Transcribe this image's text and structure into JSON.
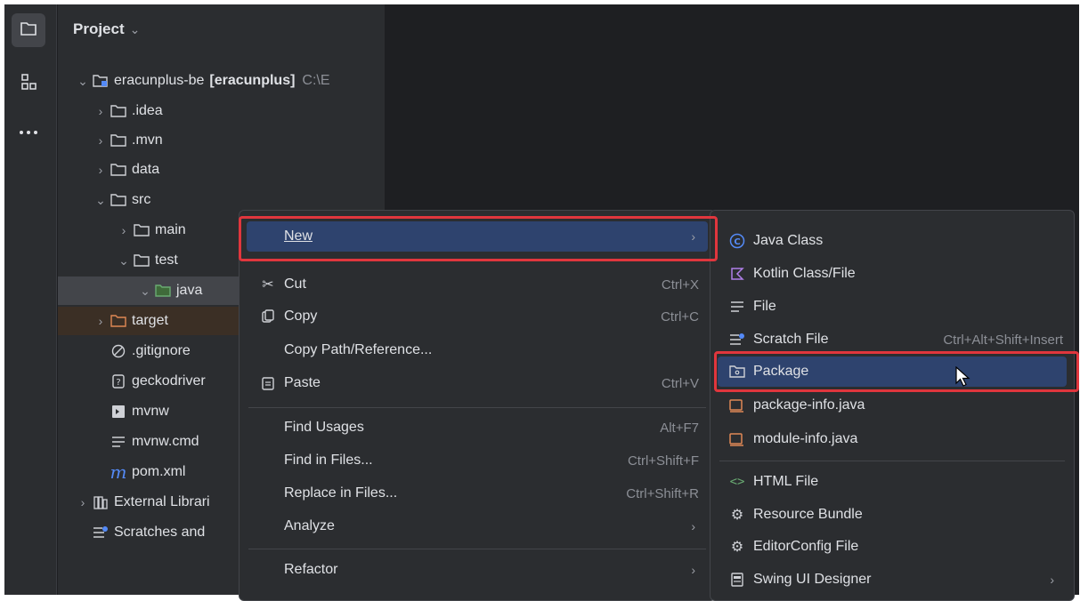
{
  "toolstrip": {
    "items": [
      {
        "icon": "folder-icon",
        "active": true
      },
      {
        "icon": "structure-icon",
        "active": false
      },
      {
        "icon": "more-icon",
        "active": false
      }
    ]
  },
  "project_panel": {
    "title": "Project",
    "tree": [
      {
        "label": "eracunplus-be",
        "module": "[eracunplus]",
        "path": "C:\\E"
      },
      {
        "label": ".idea"
      },
      {
        "label": ".mvn"
      },
      {
        "label": "data"
      },
      {
        "label": "src"
      },
      {
        "label": "main"
      },
      {
        "label": "test"
      },
      {
        "label": "java"
      },
      {
        "label": "target"
      },
      {
        "label": ".gitignore"
      },
      {
        "label": "geckodriver"
      },
      {
        "label": "mvnw"
      },
      {
        "label": "mvnw.cmd"
      },
      {
        "label": "pom.xml"
      },
      {
        "label": "External Librari"
      },
      {
        "label": "Scratches and"
      }
    ]
  },
  "context_menu": {
    "items": [
      {
        "label": "New",
        "shortcut": ""
      },
      {
        "label": "Cut",
        "shortcut": "Ctrl+X"
      },
      {
        "label": "Copy",
        "shortcut": "Ctrl+C"
      },
      {
        "label": "Copy Path/Reference...",
        "shortcut": ""
      },
      {
        "label": "Paste",
        "shortcut": "Ctrl+V"
      },
      {
        "label": "Find Usages",
        "shortcut": "Alt+F7"
      },
      {
        "label": "Find in Files...",
        "shortcut": "Ctrl+Shift+F"
      },
      {
        "label": "Replace in Files...",
        "shortcut": "Ctrl+Shift+R"
      },
      {
        "label": "Analyze",
        "shortcut": ""
      },
      {
        "label": "Refactor",
        "shortcut": ""
      }
    ]
  },
  "new_submenu": {
    "items": [
      {
        "label": "Java Class",
        "shortcut": ""
      },
      {
        "label": "Kotlin Class/File",
        "shortcut": ""
      },
      {
        "label": "File",
        "shortcut": ""
      },
      {
        "label": "Scratch File",
        "shortcut": "Ctrl+Alt+Shift+Insert"
      },
      {
        "label": "Package",
        "shortcut": ""
      },
      {
        "label": "package-info.java",
        "shortcut": ""
      },
      {
        "label": "module-info.java",
        "shortcut": ""
      },
      {
        "label": "HTML File",
        "shortcut": ""
      },
      {
        "label": "Resource Bundle",
        "shortcut": ""
      },
      {
        "label": "EditorConfig File",
        "shortcut": ""
      },
      {
        "label": "Swing UI Designer",
        "shortcut": ""
      }
    ]
  },
  "colors": {
    "background": "#1e1f22",
    "panel": "#2b2d30",
    "highlight": "#2e436e",
    "annotation": "#e0363d",
    "text": "#dfe1e5",
    "muted": "#8c8f96"
  }
}
